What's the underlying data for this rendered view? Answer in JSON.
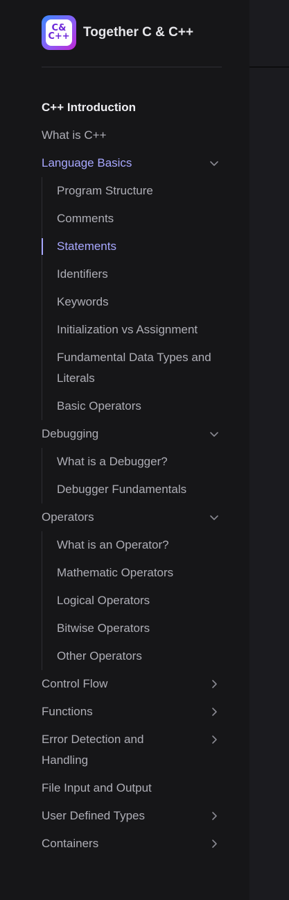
{
  "brand": {
    "title": "Together C & C++",
    "logo_text_top": "C&",
    "logo_text_bottom": "C++"
  },
  "nav": {
    "section_title": "C++ Introduction",
    "items": {
      "what_is_cpp": "What is C++",
      "language_basics": "Language Basics",
      "language_basics_sub": [
        "Program Structure",
        "Comments",
        "Statements",
        "Identifiers",
        "Keywords",
        "Initialization vs Assignment",
        "Fundamental Data Types and Literals",
        "Basic Operators"
      ],
      "debugging": "Debugging",
      "debugging_sub": [
        "What is a Debugger?",
        "Debugger Fundamentals"
      ],
      "operators": "Operators",
      "operators_sub": [
        "What is an Operator?",
        "Mathematic Operators",
        "Logical Operators",
        "Bitwise Operators",
        "Other Operators"
      ],
      "control_flow": "Control Flow",
      "functions": "Functions",
      "error_detection": "Error Detection and Handling",
      "file_io": "File Input and Output",
      "user_defined_types": "User Defined Types",
      "containers": "Containers"
    },
    "active_item": "Statements"
  },
  "colors": {
    "accent": "#a8a8ff",
    "sidebar_bg": "#161618",
    "main_bg": "#1b1b1f",
    "text": "#aeaeb6"
  },
  "icons": {
    "expanded": "chevron-down-icon",
    "collapsed": "chevron-right-icon"
  }
}
